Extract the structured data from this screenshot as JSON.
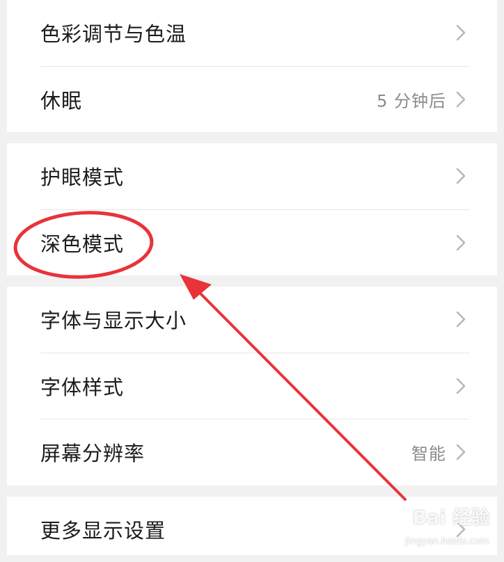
{
  "settings": {
    "groups": [
      {
        "rows": [
          {
            "label": "色彩调节与色温",
            "value": ""
          },
          {
            "label": "休眠",
            "value": "5 分钟后"
          }
        ]
      },
      {
        "rows": [
          {
            "label": "护眼模式",
            "value": ""
          },
          {
            "label": "深色模式",
            "value": ""
          }
        ]
      },
      {
        "rows": [
          {
            "label": "字体与显示大小",
            "value": ""
          },
          {
            "label": "字体样式",
            "value": ""
          },
          {
            "label": "屏幕分辨率",
            "value": "智能"
          }
        ]
      },
      {
        "rows": [
          {
            "label": "更多显示设置",
            "value": ""
          }
        ]
      }
    ]
  },
  "icons": {
    "chevron": "chevron-right-icon"
  },
  "annotation": {
    "highlighted_item": "深色模式",
    "color": "#e8333a"
  },
  "watermark": {
    "main": "Bai 经验",
    "sub": "jingyan.baidu.com"
  }
}
